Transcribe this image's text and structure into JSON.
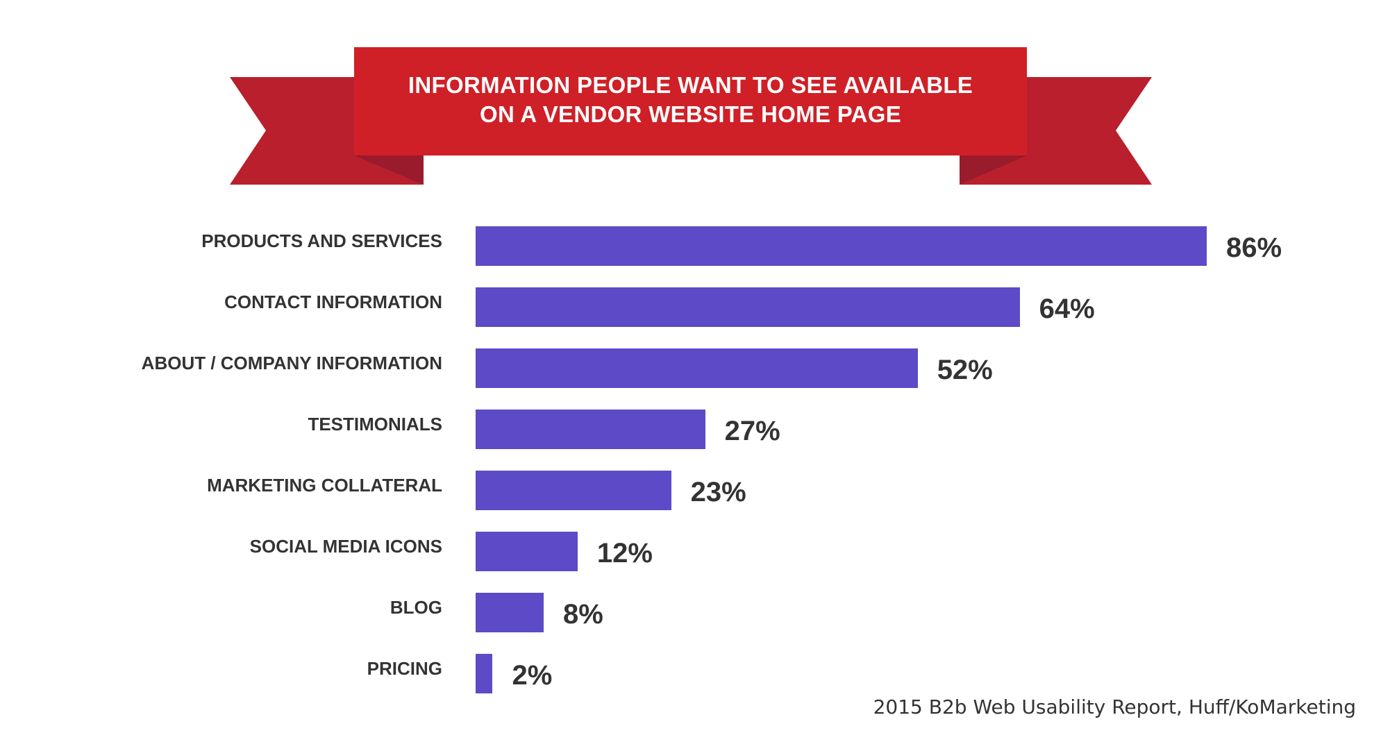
{
  "colors": {
    "ribbon_main": "#cf2027",
    "ribbon_tail": "#b91f2c",
    "ribbon_fold": "#9a1b2b",
    "bar": "#5c4ac7",
    "text": "#333333",
    "title_text": "#ffffff"
  },
  "chart_data": {
    "type": "bar",
    "orientation": "horizontal",
    "title": "INFORMATION PEOPLE WANT TO SEE AVAILABLE ON A VENDOR WEBSITE HOME PAGE",
    "title_lines": [
      "INFORMATION PEOPLE WANT TO SEE AVAILABLE",
      "ON A VENDOR WEBSITE HOME PAGE"
    ],
    "categories": [
      "PRODUCTS AND SERVICES",
      "CONTACT INFORMATION",
      "ABOUT / COMPANY INFORMATION",
      "TESTIMONIALS",
      "MARKETING COLLATERAL",
      "SOCIAL MEDIA ICONS",
      "BLOG",
      "PRICING"
    ],
    "values": [
      86,
      64,
      52,
      27,
      23,
      12,
      8,
      2
    ],
    "value_labels": [
      "86%",
      "64%",
      "52%",
      "27%",
      "23%",
      "12%",
      "8%",
      "2%"
    ],
    "unit": "%",
    "xlabel": "",
    "ylabel": "",
    "xlim": [
      0,
      86
    ],
    "grid": false,
    "legend": "none",
    "source": "2015 B2b Web Usability Report, Huff/KoMarketing"
  }
}
